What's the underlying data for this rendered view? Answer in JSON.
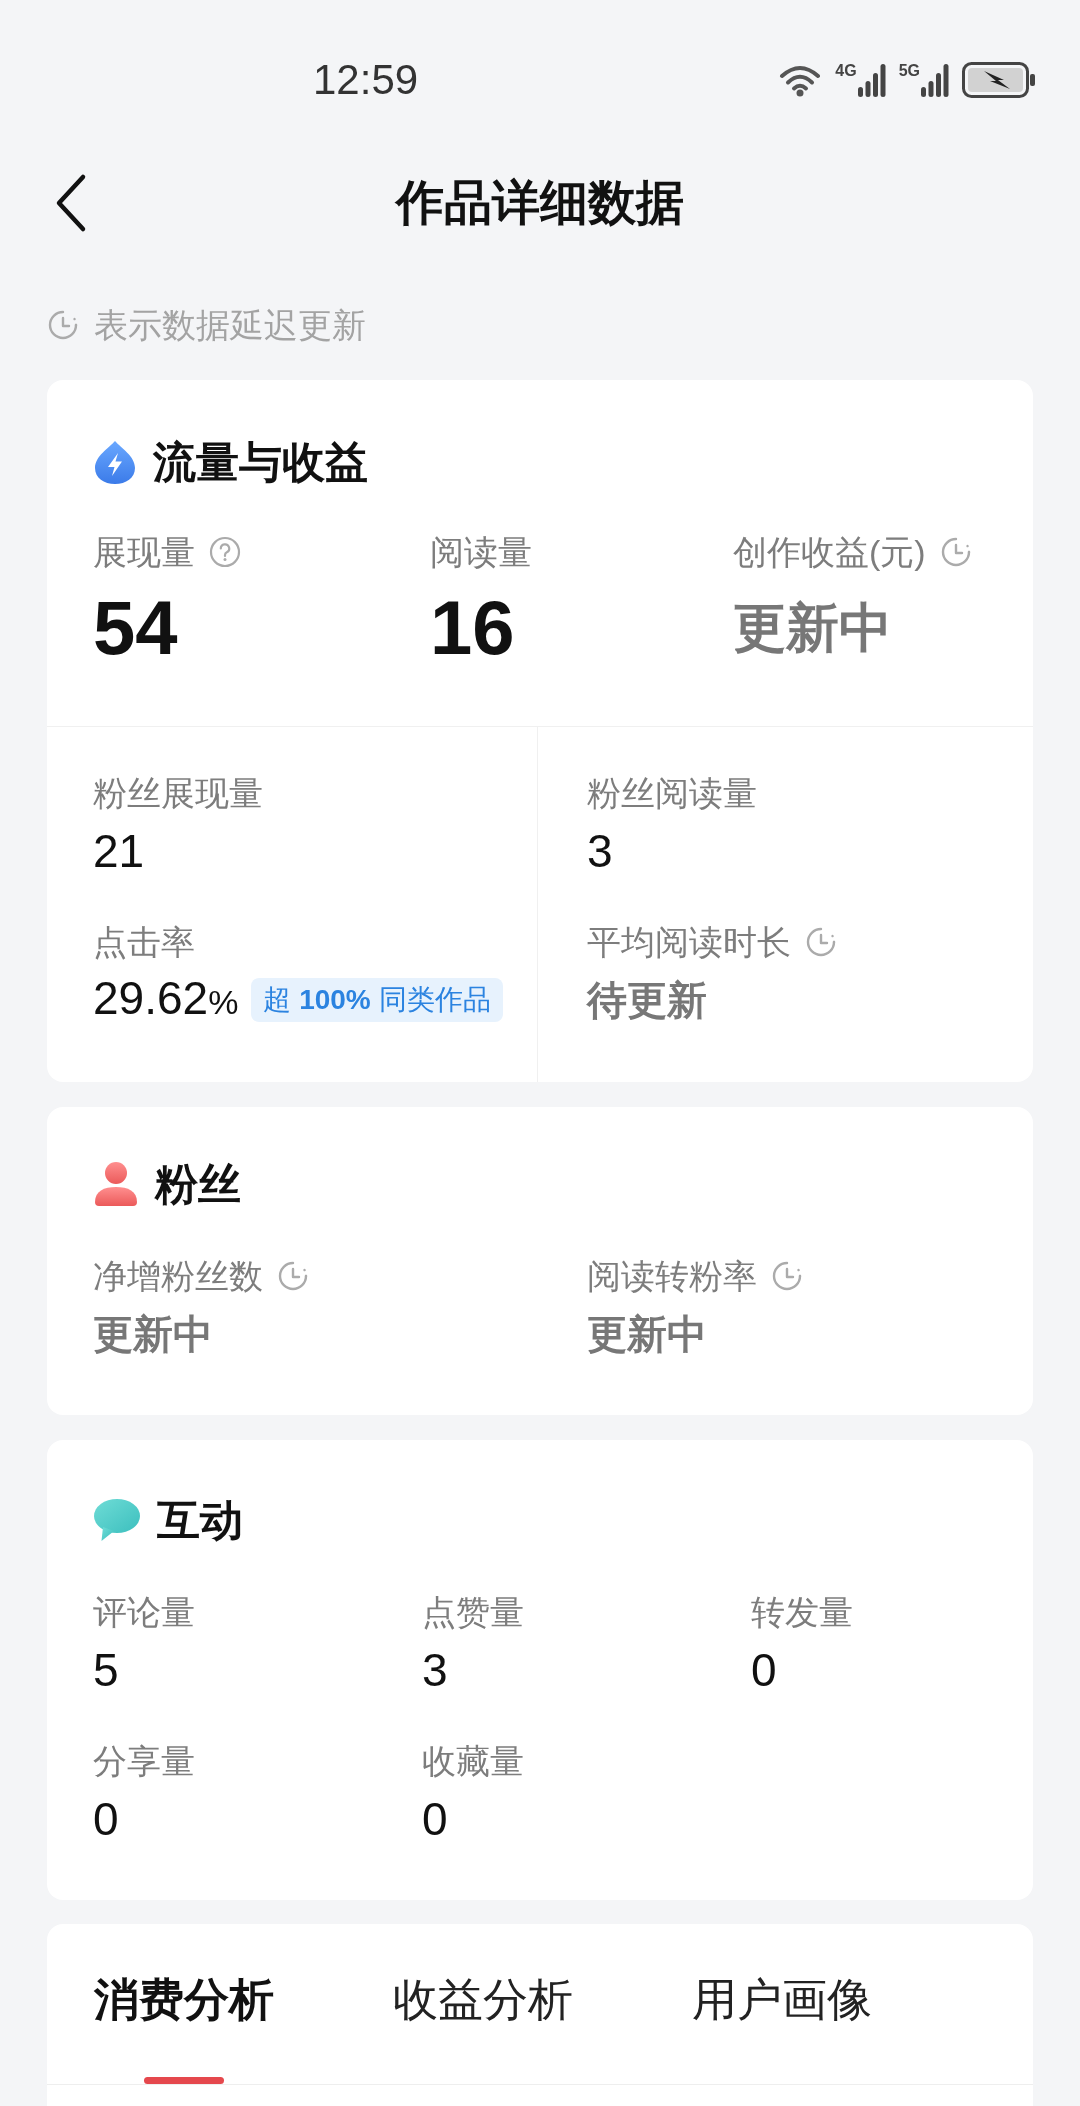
{
  "status_bar": {
    "time": "12:59",
    "networks": [
      "4G",
      "5G"
    ]
  },
  "header": {
    "title": "作品详细数据"
  },
  "notice": {
    "text": "表示数据延迟更新"
  },
  "traffic_card": {
    "title": "流量与收益",
    "metrics": [
      {
        "label": "展现量",
        "value": "54",
        "help": true,
        "delayed": false,
        "pending": false
      },
      {
        "label": "阅读量",
        "value": "16",
        "help": false,
        "delayed": false,
        "pending": false
      },
      {
        "label": "创作收益(元)",
        "value": "更新中",
        "help": false,
        "delayed": true,
        "pending": true
      }
    ],
    "panels": [
      {
        "metrics": [
          {
            "label": "粉丝展现量",
            "value": "21",
            "help": false,
            "delayed": false,
            "pending": false
          },
          {
            "label": "点击率",
            "value": "29.62",
            "unit": "%",
            "badge": "超 **100%** 同类作品",
            "help": false,
            "delayed": false,
            "pending": false
          }
        ]
      },
      {
        "metrics": [
          {
            "label": "粉丝阅读量",
            "value": "3",
            "help": false,
            "delayed": false,
            "pending": false
          },
          {
            "label": "平均阅读时长",
            "value": "待更新",
            "help": false,
            "delayed": true,
            "pending": true
          }
        ]
      }
    ]
  },
  "fans_card": {
    "title": "粉丝",
    "metrics": [
      {
        "label": "净增粉丝数",
        "value": "更新中",
        "help": false,
        "delayed": true,
        "pending": true
      },
      {
        "label": "阅读转粉率",
        "value": "更新中",
        "help": false,
        "delayed": true,
        "pending": true
      }
    ]
  },
  "interaction_card": {
    "title": "互动",
    "metrics": [
      {
        "label": "评论量",
        "value": "5",
        "help": false,
        "delayed": false,
        "pending": false
      },
      {
        "label": "点赞量",
        "value": "3",
        "help": false,
        "delayed": false,
        "pending": false
      },
      {
        "label": "转发量",
        "value": "0",
        "help": false,
        "delayed": false,
        "pending": false
      },
      {
        "label": "分享量",
        "value": "0",
        "help": false,
        "delayed": false,
        "pending": false
      },
      {
        "label": "收藏量",
        "value": "0",
        "help": false,
        "delayed": false,
        "pending": false
      }
    ]
  },
  "tabs": [
    {
      "label": "消费分析",
      "selected": true
    },
    {
      "label": "收益分析",
      "selected": false
    },
    {
      "label": "用户画像",
      "selected": false
    }
  ]
}
